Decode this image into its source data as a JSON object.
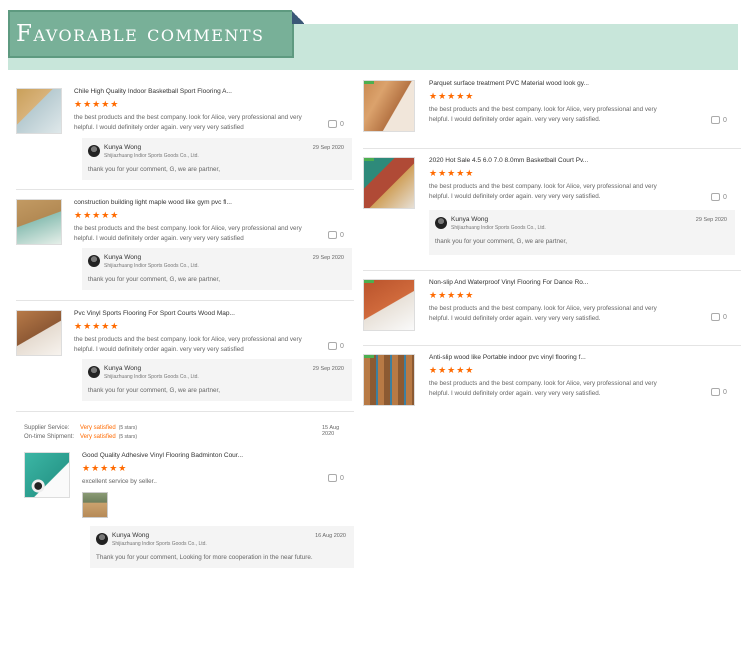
{
  "header": {
    "title": "Favorable comments"
  },
  "colors": {
    "star": "#ff6a00",
    "banner": "#78b098",
    "banner_bg": "#c8e6da"
  },
  "icons": {
    "like": "thumbs-up-icon",
    "star": "star-icon"
  },
  "left_reviews": [
    {
      "title": "Chile High Quality Indoor Basketball Sport Flooring A...",
      "stars": "★★★★★",
      "text1": "the best products and the best company. look for Alice, very professional and very",
      "text2": "helpful. I would definitely order again. very very very satisfied",
      "likes": "0",
      "reply": {
        "name": "Kunya Wong",
        "company": "Shijiazhuang Indior Sports Goods Co., Ltd.",
        "date": "29 Sep 2020",
        "text": "thank you for your comment, G, we are partner,"
      }
    },
    {
      "title": "construction building light maple wood like gym pvc fl...",
      "stars": "★★★★★",
      "text1": "the best products and the best company. look for Alice, very professional and very",
      "text2": "helpful. I would definitely order again. very very very satisfied",
      "likes": "0",
      "reply": {
        "name": "Kunya Wong",
        "company": "Shijiazhuang Indior Sports Goods Co., Ltd.",
        "date": "29 Sep 2020",
        "text": "thank you for your comment, G, we are partner,"
      }
    },
    {
      "title": "Pvc Vinyl Sports Flooring For Sport Courts Wood Map...",
      "stars": "★★★★★",
      "text1": "the best products and the best company. look for Alice, very professional and very",
      "text2": "helpful. I would definitely order again. very very very satisfied",
      "likes": "0",
      "reply": {
        "name": "Kunya Wong",
        "company": "Shijiazhuang Indior Sports Goods Co., Ltd.",
        "date": "29 Sep 2020",
        "text": "thank you for your comment, G, we are partner,"
      }
    }
  ],
  "service_review": {
    "supplier_label": "Supplier Service:",
    "supplier_value": "Very satisfied",
    "supplier_stars": "(5 stars)",
    "shipment_label": "On-time Shipment:",
    "shipment_value": "Very satisfied",
    "shipment_stars": "(5 stars)",
    "date": "15 Aug 2020",
    "title": "Good Quality Adhesive Vinyl Flooring Badminton Cour...",
    "stars": "★★★★★",
    "text": "excellent service by seller..",
    "likes": "0",
    "reply": {
      "name": "Kunya Wong",
      "company": "Shijiazhuang Indior Sports Goods Co., Ltd.",
      "date": "16 Aug 2020",
      "text": "Thank you for your comment, Looking for more cooperation in the near future."
    }
  },
  "right_reviews": [
    {
      "title": "Parquet surface treatment PVC Material wood look gy...",
      "stars": "★★★★★",
      "text1": "the best products and the best company. look for Alice, very professional and very",
      "text2": "helpful. I would definitely order again. very very very satisfied.",
      "likes": "0"
    },
    {
      "title": "2020 Hot Sale 4.5 6.0 7.0 8.0mm Basketball Court Pv...",
      "stars": "★★★★★",
      "text1": "the best products and the best company. look for Alice, very professional and very",
      "text2": "helpful. I would definitely order again. very very very satisfied.",
      "likes": "0",
      "reply": {
        "name": "Kunya Wong",
        "company": "Shijiazhuang Indior Sports Goods Co., Ltd.",
        "date": "29 Sep 2020",
        "text": "thank you for your comment, G, we are partner,"
      }
    },
    {
      "title": "Non-slip And Waterproof Vinyl Flooring For Dance Ro...",
      "stars": "★★★★★",
      "text1": "the best products and the best company. look for Alice, very professional and very",
      "text2": "helpful. I would definitely order again. very very very satisfied.",
      "likes": "0"
    },
    {
      "title": "Anti-slip wood like Portable indoor pvc vinyl flooring f...",
      "stars": "★★★★★",
      "text1": "the best products and the best company. look for Alice, very professional and very",
      "text2": "helpful. I would definitely order again. very very very satisfied.",
      "likes": "0"
    }
  ]
}
